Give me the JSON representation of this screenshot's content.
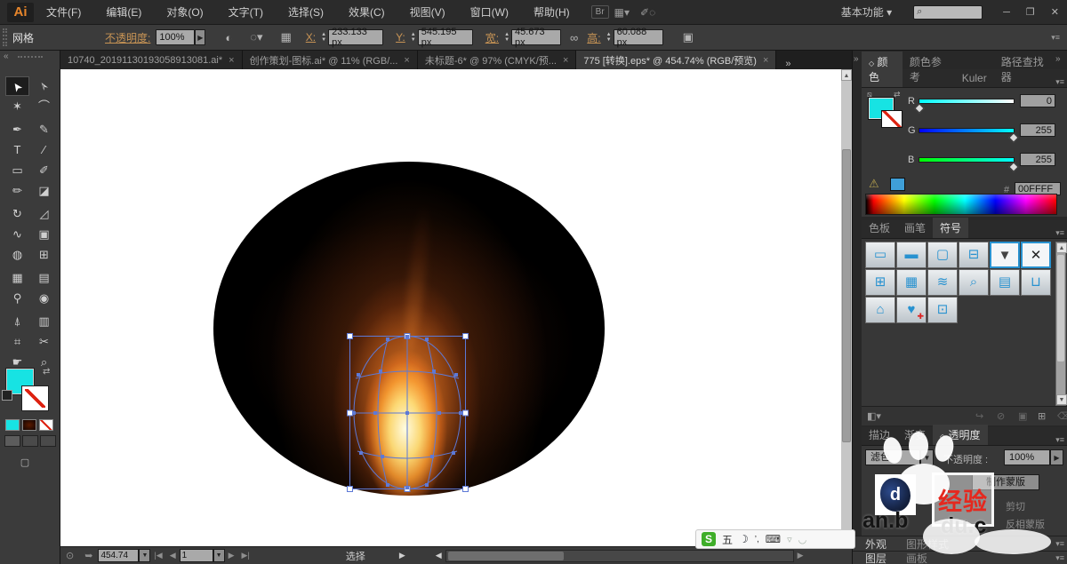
{
  "window": {
    "minimize": "─",
    "restore": "❐",
    "close": "✕"
  },
  "menubar": {
    "logo": "Ai",
    "br_label": "Br",
    "items": [
      "文件(F)",
      "编辑(E)",
      "对象(O)",
      "文字(T)",
      "选择(S)",
      "效果(C)",
      "视图(V)",
      "窗口(W)",
      "帮助(H)"
    ],
    "workspace_label": "基本功能 ▾"
  },
  "controlbar": {
    "context_label": "网格",
    "opacity_label": "不透明度:",
    "opacity_value": "100%",
    "x_label": "X:",
    "x_value": "233.133 px",
    "y_label": "Y:",
    "y_value": "545.195 px",
    "width_label": "宽:",
    "width_value": "45.673 px",
    "height_label": "高:",
    "height_value": "60.088 px"
  },
  "tabs": {
    "close": "×",
    "overflow": "»",
    "items": [
      "10740_20191130193058913081.ai*",
      "创作策划-图标.ai* @ 11% (RGB/...",
      "未标题-6* @ 97% (CMYK/预...",
      "775 [转换].eps* @ 454.74% (RGB/预览)"
    ]
  },
  "toolbar": {
    "collapse": "«",
    "tools": [
      {
        "g": "➤"
      },
      {
        "g": "➢"
      },
      {
        "g": "✶"
      },
      {
        "g": "⌒"
      },
      {
        "g": "✒"
      },
      {
        "g": "✎"
      },
      {
        "g": "T"
      },
      {
        "g": "∕"
      },
      {
        "g": "▭"
      },
      {
        "g": "✐"
      },
      {
        "g": "✏"
      },
      {
        "g": "◪"
      },
      {
        "g": "↻"
      },
      {
        "g": "◿"
      },
      {
        "g": "∿"
      },
      {
        "g": "▣"
      },
      {
        "g": "◍"
      },
      {
        "g": "⊞"
      },
      {
        "g": "▦"
      },
      {
        "g": "▤"
      },
      {
        "g": "⚲"
      },
      {
        "g": "◉"
      },
      {
        "g": "⍋"
      },
      {
        "g": "▥"
      },
      {
        "g": "⌗"
      },
      {
        "g": "✂"
      },
      {
        "g": "☛"
      },
      {
        "g": "⌕"
      }
    ]
  },
  "colorpanel": {
    "tabs": [
      "颜色",
      "颜色参考",
      "Kuler",
      "路径查找器"
    ],
    "r_label": "R",
    "r_value": "0",
    "g_label": "G",
    "g_value": "255",
    "b_label": "B",
    "b_value": "255",
    "hex_label": "#",
    "hex_value": "00FFFF"
  },
  "swatchpanel": {
    "tabs": [
      "色板",
      "画笔",
      "符号"
    ],
    "symbols": [
      {
        "g": "▭"
      },
      {
        "g": "▬"
      },
      {
        "g": "▢"
      },
      {
        "g": "⊟"
      },
      {
        "g": "▼"
      },
      {
        "g": "✕"
      },
      {
        "g": "⊞"
      },
      {
        "g": "▦"
      },
      {
        "g": "≋"
      },
      {
        "g": "⌕"
      },
      {
        "g": "▤"
      },
      {
        "g": "⊔"
      },
      {
        "g": "⌂"
      },
      {
        "g": "♥"
      },
      {
        "g": "⊡"
      }
    ]
  },
  "transparencypanel": {
    "tabs": [
      "描边",
      "渐变",
      "透明度"
    ],
    "blend_mode": "滤色",
    "opacity_label": "不透明度 :",
    "opacity_value": "100%",
    "make_mask_label": "制作蒙版",
    "clip_label": "剪切",
    "invert_label": "反相蒙版"
  },
  "collapsed": {
    "row1": [
      "外观",
      "图形样式"
    ],
    "row2": [
      "图层",
      "画板"
    ]
  },
  "statusbar": {
    "zoom_value": "454.74",
    "artboard_value": "1",
    "status_text": "选择"
  },
  "ime": {
    "wubi": "五"
  },
  "watermark": {
    "brand": "经验",
    "logo_letter": "d",
    "frag1": "an.b",
    "frag2": "du.c"
  }
}
